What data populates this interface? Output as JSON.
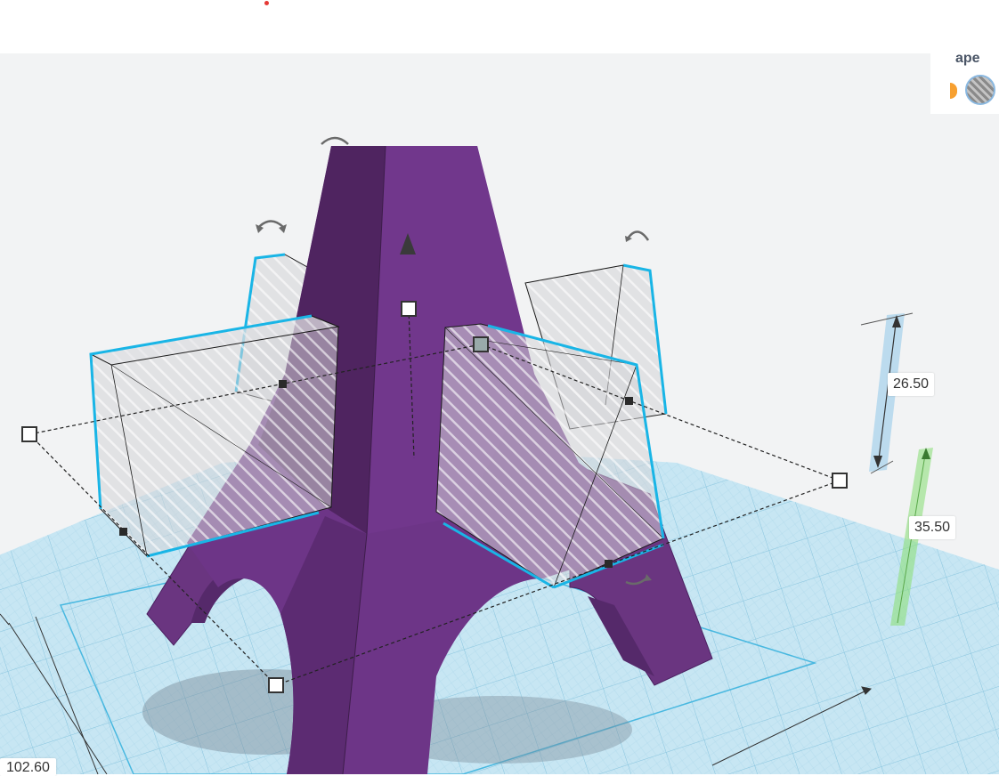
{
  "inspector": {
    "title_fragment": "ape",
    "colors": {
      "solid": "#f7a030",
      "hole": "hatched-gray"
    },
    "active_swatch": "hole"
  },
  "dimensions": {
    "height": "26.50",
    "elevation": "35.50",
    "width": "102.60"
  },
  "model": {
    "tower_color": "#6a3580",
    "selection_outline_color": "#19b5e6",
    "hole_blocks": 4,
    "workplane_color": "#c7e6f3"
  },
  "icons": [
    "rotate-arrow-icon",
    "lift-arrow-icon",
    "resize-handle-icon"
  ]
}
